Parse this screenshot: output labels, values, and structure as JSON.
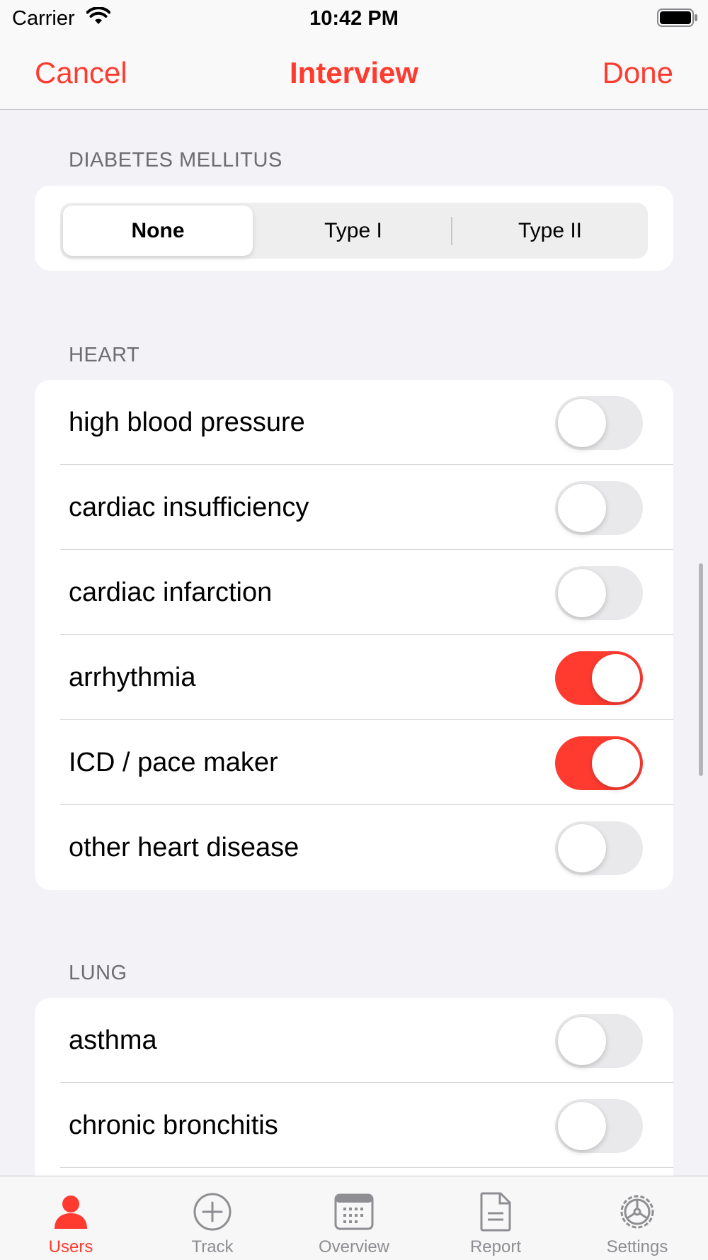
{
  "status_bar": {
    "carrier": "Carrier",
    "time": "10:42 PM"
  },
  "nav": {
    "cancel": "Cancel",
    "title": "Interview",
    "done": "Done"
  },
  "diabetes": {
    "header": "DIABETES MELLITUS",
    "options": [
      "None",
      "Type I",
      "Type II"
    ],
    "selected": "None"
  },
  "heart": {
    "header": "HEART",
    "items": [
      {
        "label": "high blood pressure",
        "on": false
      },
      {
        "label": "cardiac insufficiency",
        "on": false
      },
      {
        "label": "cardiac infarction",
        "on": false
      },
      {
        "label": "arrhythmia",
        "on": true
      },
      {
        "label": "ICD / pace maker",
        "on": true
      },
      {
        "label": "other heart disease",
        "on": false
      }
    ]
  },
  "lung": {
    "header": "LUNG",
    "items": [
      {
        "label": "asthma",
        "on": false
      },
      {
        "label": "chronic bronchitis",
        "on": false
      }
    ]
  },
  "tabs": [
    {
      "label": "Users",
      "icon": "person-icon",
      "active": true
    },
    {
      "label": "Track",
      "icon": "plus-circle-icon",
      "active": false
    },
    {
      "label": "Overview",
      "icon": "calendar-icon",
      "active": false
    },
    {
      "label": "Report",
      "icon": "document-icon",
      "active": false
    },
    {
      "label": "Settings",
      "icon": "gear-icon",
      "active": false
    }
  ],
  "colors": {
    "accent": "#ff3b30",
    "toggle_off": "#e9e9eb",
    "background": "#f2f2f7"
  }
}
